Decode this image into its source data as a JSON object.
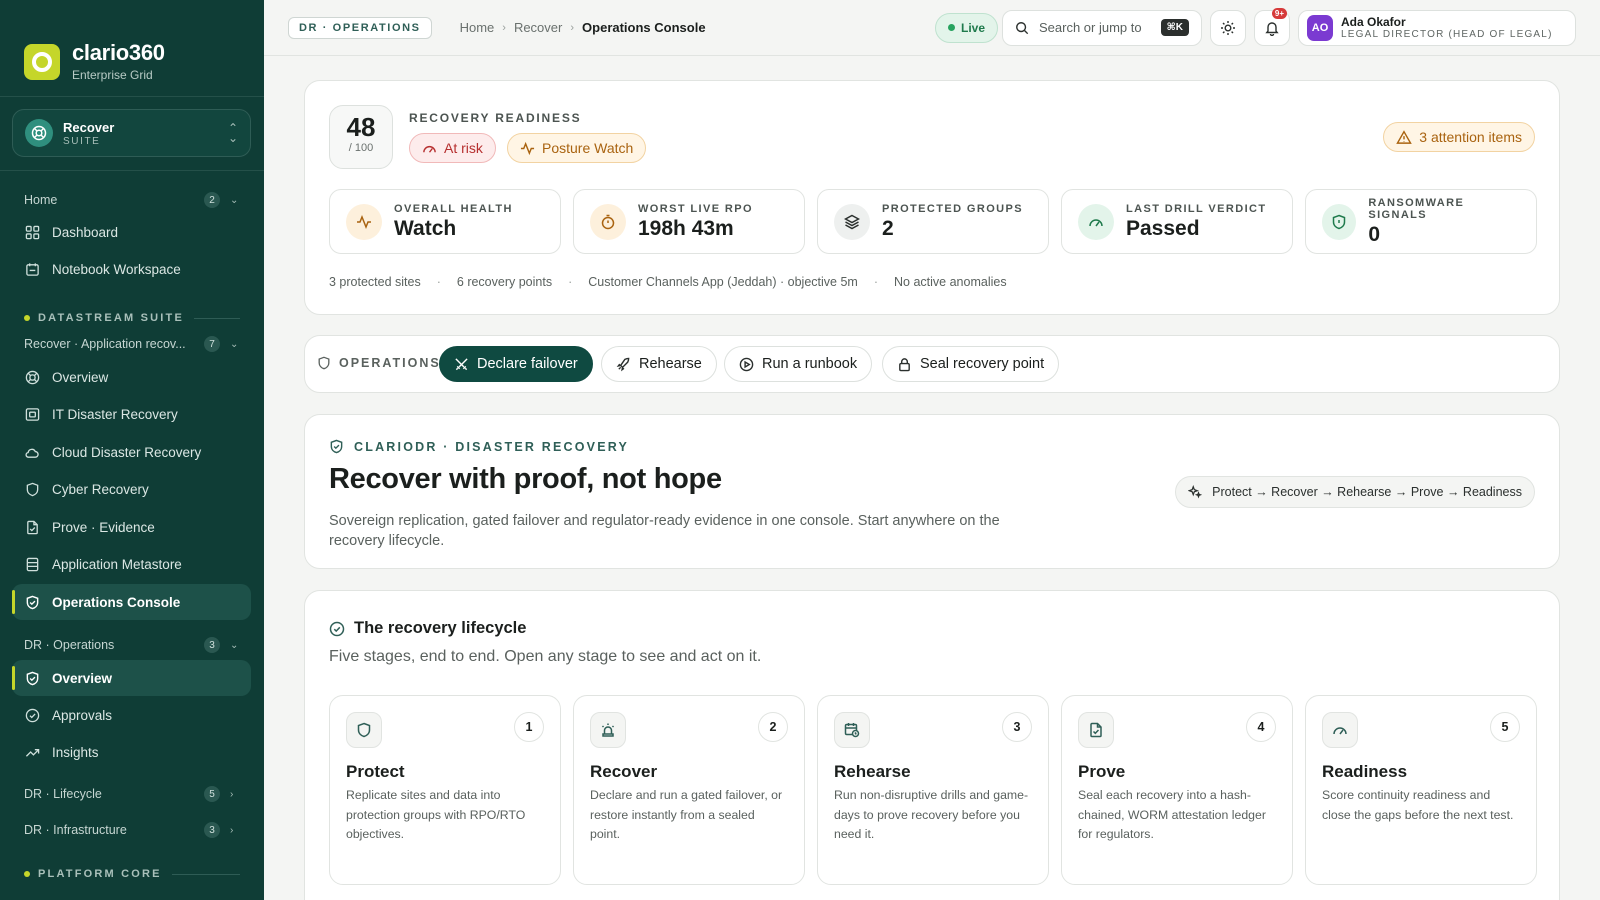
{
  "brand": {
    "name": "clario360",
    "sub": "Enterprise Grid"
  },
  "suite": {
    "name": "Recover",
    "sub": "SUITE"
  },
  "nav": {
    "home_group": {
      "label": "Home",
      "count": "2"
    },
    "home_items": [
      "Dashboard",
      "Notebook Workspace"
    ],
    "datastream_section": "DATASTREAM SUITE",
    "recover_group": {
      "label": "Recover · Application recov...",
      "count": "7"
    },
    "recover_items": [
      "Overview",
      "IT Disaster Recovery",
      "Cloud Disaster Recovery",
      "Cyber Recovery",
      "Prove · Evidence",
      "Application Metastore",
      "Operations Console"
    ],
    "dr_ops_group": {
      "label": "DR · Operations",
      "count": "3"
    },
    "dr_ops_items": [
      "Overview",
      "Approvals",
      "Insights"
    ],
    "dr_lifecycle_group": {
      "label": "DR · Lifecycle",
      "count": "5"
    },
    "dr_infra_group": {
      "label": "DR · Infrastructure",
      "count": "3"
    },
    "platform_section": "PLATFORM CORE"
  },
  "topbar": {
    "tag": "DR · OPERATIONS",
    "breadcrumbs": [
      "Home",
      "Recover",
      "Operations Console"
    ],
    "live": "Live",
    "search_placeholder": "Search or jump to",
    "search_kbd": "⌘K",
    "notif_badge": "9+",
    "user": {
      "initials": "AO",
      "name": "Ada Okafor",
      "role": "LEGAL DIRECTOR (HEAD OF LEGAL)"
    }
  },
  "readiness": {
    "score": "48",
    "score_max": "/ 100",
    "label": "RECOVERY READINESS",
    "status": "At risk",
    "posture": "Posture Watch",
    "attention": "3 attention items",
    "stats": [
      {
        "label": "OVERALL HEALTH",
        "value": "Watch"
      },
      {
        "label": "WORST LIVE RPO",
        "value": "198h 43m"
      },
      {
        "label": "PROTECTED GROUPS",
        "value": "2"
      },
      {
        "label": "LAST DRILL VERDICT",
        "value": "Passed"
      },
      {
        "label": "RANSOMWARE SIGNALS",
        "value": "0"
      }
    ],
    "meta": [
      "3 protected sites",
      "6 recovery points",
      "Customer Channels App (Jeddah) · objective 5m",
      "No active anomalies"
    ]
  },
  "operations": {
    "label": "OPERATIONS",
    "buttons": [
      "Declare failover",
      "Rehearse",
      "Run a runbook",
      "Seal recovery point"
    ]
  },
  "hero": {
    "kicker": "CLARIODR · DISASTER RECOVERY",
    "title": "Recover with proof, not hope",
    "desc": "Sovereign replication, gated failover and regulator-ready evidence in one console. Start anywhere on the recovery lifecycle.",
    "flow": "Protect → Recover → Rehearse → Prove → Readiness"
  },
  "lifecycle": {
    "title": "The recovery lifecycle",
    "subtitle": "Five stages, end to end. Open any stage to see and act on it.",
    "stages": [
      {
        "num": "1",
        "name": "Protect",
        "desc": "Replicate sites and data into protection groups with RPO/RTO objectives."
      },
      {
        "num": "2",
        "name": "Recover",
        "desc": "Declare and run a gated failover, or restore instantly from a sealed point."
      },
      {
        "num": "3",
        "name": "Rehearse",
        "desc": "Run non-disruptive drills and game-days to prove recovery before you need it."
      },
      {
        "num": "4",
        "name": "Prove",
        "desc": "Seal each recovery into a hash-chained, WORM attestation ledger for regulators."
      },
      {
        "num": "5",
        "name": "Readiness",
        "desc": "Score continuity readiness and close the gaps before the next test."
      }
    ]
  },
  "colors": {
    "sidebar": "#0f3d36",
    "accent": "#c5d62a",
    "primary": "#0f4a41",
    "danger": "#b62f2f",
    "warning": "#a96310"
  }
}
